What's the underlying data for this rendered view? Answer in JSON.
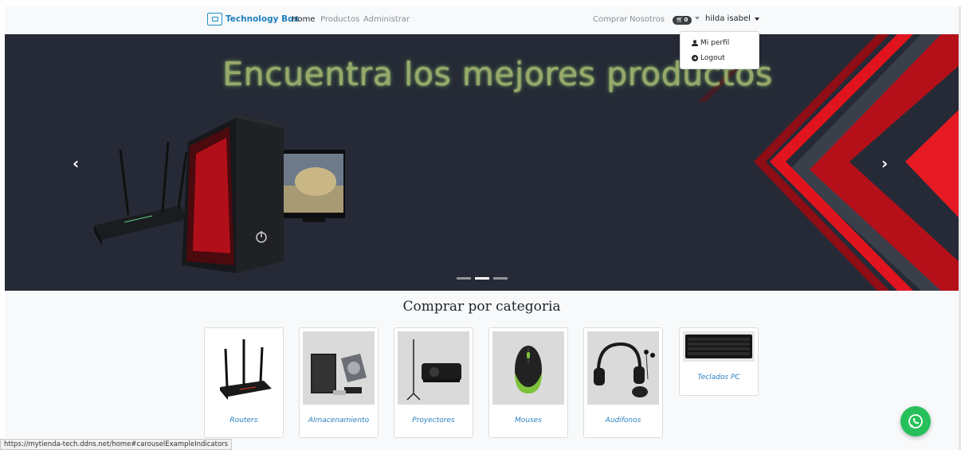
{
  "navbar": {
    "brand": "Technology Box",
    "links": {
      "home": "Home",
      "productos": "Productos",
      "administrar": "Administrar",
      "comprar": "Comprar",
      "nosotros": "Nosotros"
    },
    "cart_count": "0",
    "user_name": "hilda isabel"
  },
  "dropdown": {
    "profile": "Mi perfil",
    "logout": "Logout"
  },
  "carousel": {
    "title": "Encuentra los mejores productos",
    "prev": "‹",
    "next": "›",
    "slides": 3,
    "active_slide": 2
  },
  "section": {
    "title": "Comprar por categoria"
  },
  "categories": [
    {
      "label": "Routers",
      "icon": "router-image"
    },
    {
      "label": "Almacenamiento",
      "icon": "storage-image"
    },
    {
      "label": "Proyectores",
      "icon": "projector-image"
    },
    {
      "label": "Mouses",
      "icon": "mouse-image"
    },
    {
      "label": "Audifonos",
      "icon": "headphones-image"
    },
    {
      "label": "Teclados PC",
      "icon": "keyboard-image"
    }
  ],
  "status_bar": {
    "url": "https://mytienda-tech.ddns.net/home#carouselExampleIndicators"
  },
  "colors": {
    "link_blue": "#2a7fbf",
    "carousel_bg": "#262a36",
    "accent_red": "#e0141e",
    "whatsapp_green": "#25c05a"
  }
}
